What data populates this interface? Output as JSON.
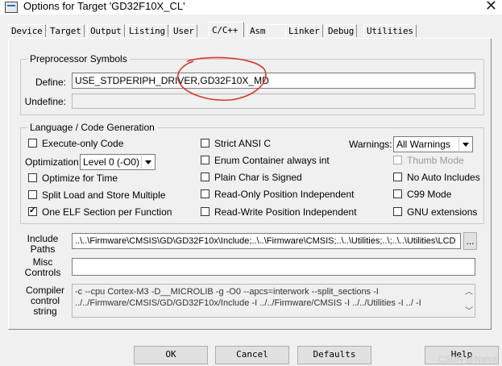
{
  "window": {
    "title": "Options for Target 'GD32F10X_CL'",
    "close_glyph": "✕"
  },
  "tabs": [
    {
      "label": "Device"
    },
    {
      "label": "Target"
    },
    {
      "label": "Output"
    },
    {
      "label": "Listing"
    },
    {
      "label": "User"
    },
    {
      "label": "C/C++"
    },
    {
      "label": "Asm"
    },
    {
      "label": "Linker"
    },
    {
      "label": "Debug"
    },
    {
      "label": "Utilities"
    }
  ],
  "active_tab": "C/C++",
  "preprocessor": {
    "legend": "Preprocessor Symbols",
    "define_label": "Define:",
    "define_value": "USE_STDPERIPH_DRIVER,GD32F10X_MD",
    "undefine_label": "Undefine:",
    "undefine_value": ""
  },
  "language": {
    "legend": "Language / Code Generation",
    "execute_only": {
      "label": "Execute-only Code",
      "checked": false
    },
    "optimization_label": "Optimization:",
    "optimization_value": "Level 0 (-O0)",
    "optimize_time": {
      "label": "Optimize for Time",
      "checked": false
    },
    "split_load": {
      "label": "Split Load and Store Multiple",
      "checked": false
    },
    "one_elf": {
      "label": "One ELF Section per Function",
      "checked": true
    },
    "strict_ansi": {
      "label": "Strict ANSI C",
      "checked": false
    },
    "enum_container": {
      "label": "Enum Container always int",
      "checked": false
    },
    "plain_char": {
      "label": "Plain Char is Signed",
      "checked": false
    },
    "ro_pos_ind": {
      "label": "Read-Only Position Independent",
      "checked": false
    },
    "rw_pos_ind": {
      "label": "Read-Write Position Independent",
      "checked": false
    },
    "warnings_label": "Warnings:",
    "warnings_value": "All Warnings",
    "thumb_mode": {
      "label": "Thumb Mode",
      "checked": false,
      "disabled": true
    },
    "no_auto_includes": {
      "label": "No Auto Includes",
      "checked": false
    },
    "c99_mode": {
      "label": "C99 Mode",
      "checked": false
    },
    "gnu_extensions": {
      "label": "GNU extensions",
      "checked": false
    }
  },
  "paths": {
    "include_label_1": "Include",
    "include_label_2": "Paths",
    "include_value": "..\\..\\Firmware\\CMSIS\\GD\\GD32F10x\\Include;..\\..\\Firmware\\CMSIS;..\\..\\Utilities;..\\;..\\..\\Utilities\\LCD",
    "browse_label": "...",
    "misc_label_1": "Misc",
    "misc_label_2": "Controls",
    "misc_value": "",
    "compiler_label_1": "Compiler",
    "compiler_label_2": "control",
    "compiler_label_3": "string",
    "compiler_line_1": "-c --cpu Cortex-M3 -D__MICROLIB -g -O0 --apcs=interwork --split_sections -I",
    "compiler_line_2": "../../Firmware/CMSIS/GD/GD32F10x/Include -I ../../Firmware/CMSIS -I ../../Utilities -I ../ -I"
  },
  "buttons": {
    "ok": "OK",
    "cancel": "Cancel",
    "defaults": "Defaults",
    "help": "Help"
  },
  "watermark": "CSDN @Naiva",
  "colors": {
    "annotation": "#d9382c",
    "field_border": "#7a7a7a"
  }
}
